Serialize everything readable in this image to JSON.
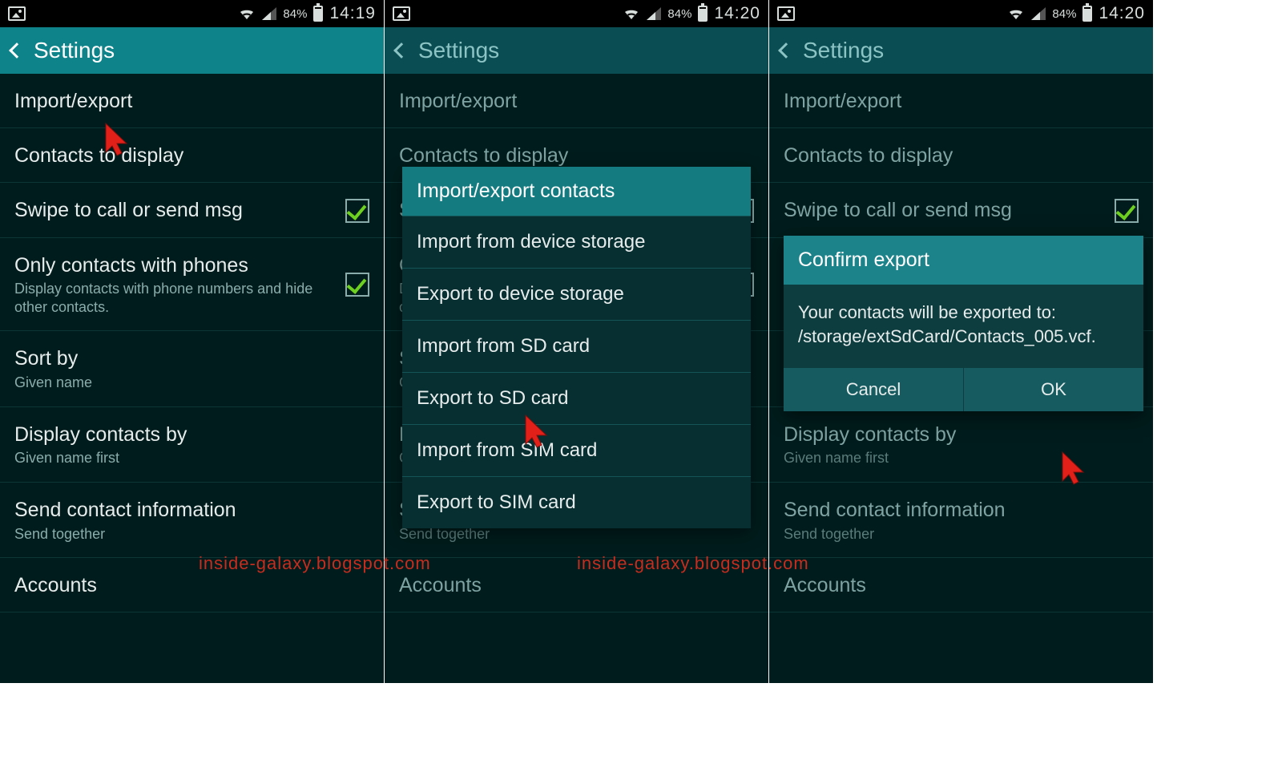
{
  "statusbar": {
    "battery": "84%"
  },
  "screens": [
    {
      "time": "14:19",
      "header": {
        "title": "Settings"
      },
      "dim": false
    },
    {
      "time": "14:20",
      "header": {
        "title": "Settings"
      },
      "dim": true
    },
    {
      "time": "14:20",
      "header": {
        "title": "Settings"
      },
      "dim": true
    }
  ],
  "rows": {
    "import_export": {
      "title": "Import/export"
    },
    "contacts_to_display": {
      "title": "Contacts to display"
    },
    "swipe_call": {
      "title": "Swipe to call or send msg",
      "checked": true
    },
    "only_phones": {
      "title": "Only contacts with phones",
      "sub": "Display contacts with phone numbers and hide other contacts.",
      "checked": true
    },
    "sort_by": {
      "title": "Sort by",
      "sub": "Given name"
    },
    "display_by": {
      "title": "Display contacts by",
      "sub": "Given name first"
    },
    "send_contact": {
      "title": "Send contact information",
      "sub": "Send together"
    },
    "accounts": {
      "title": "Accounts"
    }
  },
  "modal": {
    "title": "Import/export contacts",
    "items": [
      "Import from device storage",
      "Export to device storage",
      "Import from SD card",
      "Export to SD card",
      "Import from SIM card",
      "Export to SIM card"
    ]
  },
  "dialog": {
    "title": "Confirm export",
    "body": "Your contacts will be exported to: /storage/extSdCard/Contacts_005.vcf.",
    "cancel": "Cancel",
    "ok": "OK"
  },
  "watermark": "inside-galaxy.blogspot.com"
}
